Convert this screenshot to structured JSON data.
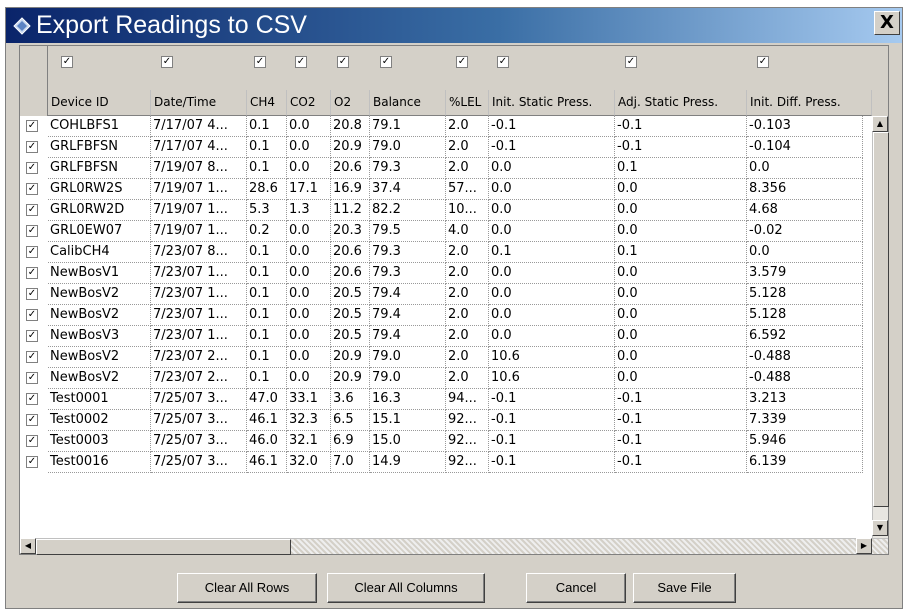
{
  "window": {
    "title": "Export Readings to CSV",
    "close_glyph": "X"
  },
  "check_glyph": "✓",
  "columns": [
    {
      "label": "Device ID"
    },
    {
      "label": "Date/Time"
    },
    {
      "label": "CH4"
    },
    {
      "label": "CO2"
    },
    {
      "label": "O2"
    },
    {
      "label": "Balance"
    },
    {
      "label": "%LEL"
    },
    {
      "label": "Init. Static Press."
    },
    {
      "label": "Adj. Static Press."
    },
    {
      "label": "Init. Diff. Press."
    }
  ],
  "rows": [
    [
      "COHLBFS1",
      "7/17/07 4...",
      "0.1",
      "0.0",
      "20.8",
      "79.1",
      "2.0",
      "-0.1",
      "-0.1",
      "-0.103"
    ],
    [
      "GRLFBFSN",
      "7/17/07 4...",
      "0.1",
      "0.0",
      "20.9",
      "79.0",
      "2.0",
      "-0.1",
      "-0.1",
      "-0.104"
    ],
    [
      "GRLFBFSN",
      "7/19/07 8...",
      "0.1",
      "0.0",
      "20.6",
      "79.3",
      "2.0",
      "0.0",
      "0.1",
      "0.0"
    ],
    [
      "GRL0RW2S",
      "7/19/07 1...",
      "28.6",
      "17.1",
      "16.9",
      "37.4",
      "57...",
      "0.0",
      "0.0",
      "8.356"
    ],
    [
      "GRL0RW2D",
      "7/19/07 1...",
      "5.3",
      "1.3",
      "11.2",
      "82.2",
      "10...",
      "0.0",
      "0.0",
      "4.68"
    ],
    [
      "GRL0EW07",
      "7/19/07 1...",
      "0.2",
      "0.0",
      "20.3",
      "79.5",
      "4.0",
      "0.0",
      "0.0",
      "-0.02"
    ],
    [
      "CalibCH4",
      "7/23/07 8...",
      "0.1",
      "0.0",
      "20.6",
      "79.3",
      "2.0",
      "0.1",
      "0.1",
      "0.0"
    ],
    [
      "NewBosV1",
      "7/23/07 1...",
      "0.1",
      "0.0",
      "20.6",
      "79.3",
      "2.0",
      "0.0",
      "0.0",
      "3.579"
    ],
    [
      "NewBosV2",
      "7/23/07 1...",
      "0.1",
      "0.0",
      "20.5",
      "79.4",
      "2.0",
      "0.0",
      "0.0",
      "5.128"
    ],
    [
      "NewBosV2",
      "7/23/07 1...",
      "0.1",
      "0.0",
      "20.5",
      "79.4",
      "2.0",
      "0.0",
      "0.0",
      "5.128"
    ],
    [
      "NewBosV3",
      "7/23/07 1...",
      "0.1",
      "0.0",
      "20.5",
      "79.4",
      "2.0",
      "0.0",
      "0.0",
      "6.592"
    ],
    [
      "NewBosV2",
      "7/23/07 2...",
      "0.1",
      "0.0",
      "20.9",
      "79.0",
      "2.0",
      "10.6",
      "0.0",
      "-0.488"
    ],
    [
      "NewBosV2",
      "7/23/07 2...",
      "0.1",
      "0.0",
      "20.9",
      "79.0",
      "2.0",
      "10.6",
      "0.0",
      "-0.488"
    ],
    [
      "Test0001",
      "7/25/07 3...",
      "47.0",
      "33.1",
      "3.6",
      "16.3",
      "94...",
      "-0.1",
      "-0.1",
      "3.213"
    ],
    [
      "Test0002",
      "7/25/07 3...",
      "46.1",
      "32.3",
      "6.5",
      "15.1",
      "92...",
      "-0.1",
      "-0.1",
      "7.339"
    ],
    [
      "Test0003",
      "7/25/07 3...",
      "46.0",
      "32.1",
      "6.9",
      "15.0",
      "92...",
      "-0.1",
      "-0.1",
      "5.946"
    ],
    [
      "Test0016",
      "7/25/07 3...",
      "46.1",
      "32.0",
      "7.0",
      "14.9",
      "92...",
      "-0.1",
      "-0.1",
      "6.139"
    ]
  ],
  "buttons": {
    "clear_rows": "Clear All Rows",
    "clear_columns": "Clear All Columns",
    "cancel": "Cancel",
    "save": "Save File"
  },
  "scroll_glyphs": {
    "up": "▲",
    "down": "▼",
    "left": "◀",
    "right": "▶"
  },
  "colors": {
    "title_start": "#0a246a",
    "title_end": "#a6caf0",
    "face": "#d4d0c8"
  }
}
